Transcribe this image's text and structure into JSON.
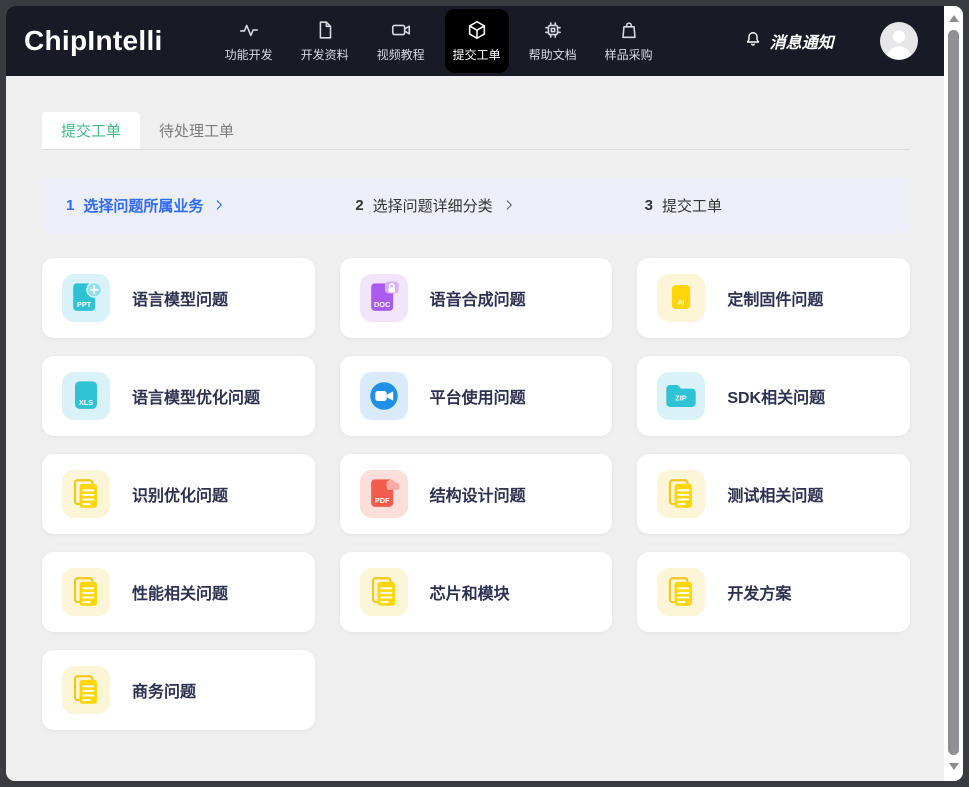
{
  "colors": {
    "brand_green": "#42b983",
    "active_blue": "#2e6bee",
    "header_bg": "#181a26",
    "nav_active_bg": "#000000",
    "page_bg": "#efefef"
  },
  "header": {
    "logo": "ChipIntelli",
    "nav": [
      {
        "label": "功能开发",
        "icon": "activity-icon",
        "active": false
      },
      {
        "label": "开发资料",
        "icon": "file-icon",
        "active": false
      },
      {
        "label": "视频教程",
        "icon": "video-icon",
        "active": false
      },
      {
        "label": "提交工单",
        "icon": "cube-icon",
        "active": true
      },
      {
        "label": "帮助文档",
        "icon": "chip-icon",
        "active": false
      },
      {
        "label": "样品采购",
        "icon": "shopping-bag-icon",
        "active": false
      }
    ],
    "notification": {
      "label": "消息通知",
      "icon": "bell-icon"
    }
  },
  "tabs": [
    {
      "label": "提交工单",
      "active": true
    },
    {
      "label": "待处理工单",
      "active": false
    }
  ],
  "steps": [
    {
      "number": "1",
      "label": "选择问题所属业务",
      "chevron": true,
      "active": true
    },
    {
      "number": "2",
      "label": "选择问题详细分类",
      "chevron": true,
      "active": false
    },
    {
      "number": "3",
      "label": "提交工单",
      "chevron": false,
      "active": false
    }
  ],
  "categories": [
    {
      "label": "语言模型问题",
      "icon": "ppt-file-icon",
      "file_label": "PPT",
      "tile_color": "#d8f2f7"
    },
    {
      "label": "语音合成问题",
      "icon": "doc-file-icon",
      "file_label": "DOC",
      "tile_color": "#f2e4fb"
    },
    {
      "label": "定制固件问题",
      "icon": "ai-file-icon",
      "file_label": "AI",
      "tile_color": "#fdf5d8"
    },
    {
      "label": "语言模型优化问题",
      "icon": "xls-file-icon",
      "file_label": "XLS",
      "tile_color": "#d8f2f7"
    },
    {
      "label": "平台使用问题",
      "icon": "video-camera-icon",
      "file_label": "",
      "tile_color": "#d9eafa"
    },
    {
      "label": "SDK相关问题",
      "icon": "zip-folder-icon",
      "file_label": "ZIP",
      "tile_color": "#d8f2f7"
    },
    {
      "label": "识别优化问题",
      "icon": "pages-icon",
      "file_label": "",
      "tile_color": "#fdf5d8"
    },
    {
      "label": "结构设计问题",
      "icon": "pdf-file-icon",
      "file_label": "PDF",
      "tile_color": "#fcdfdb"
    },
    {
      "label": "测试相关问题",
      "icon": "pages-icon",
      "file_label": "",
      "tile_color": "#fdf5d8"
    },
    {
      "label": "性能相关问题",
      "icon": "pages-icon",
      "file_label": "",
      "tile_color": "#fdf5d8"
    },
    {
      "label": "芯片和模块",
      "icon": "pages-icon",
      "file_label": "",
      "tile_color": "#fdf5d8"
    },
    {
      "label": "开发方案",
      "icon": "pages-icon",
      "file_label": "",
      "tile_color": "#fdf5d8"
    },
    {
      "label": "商务问题",
      "icon": "pages-icon",
      "file_label": "",
      "tile_color": "#fdf5d8"
    }
  ]
}
